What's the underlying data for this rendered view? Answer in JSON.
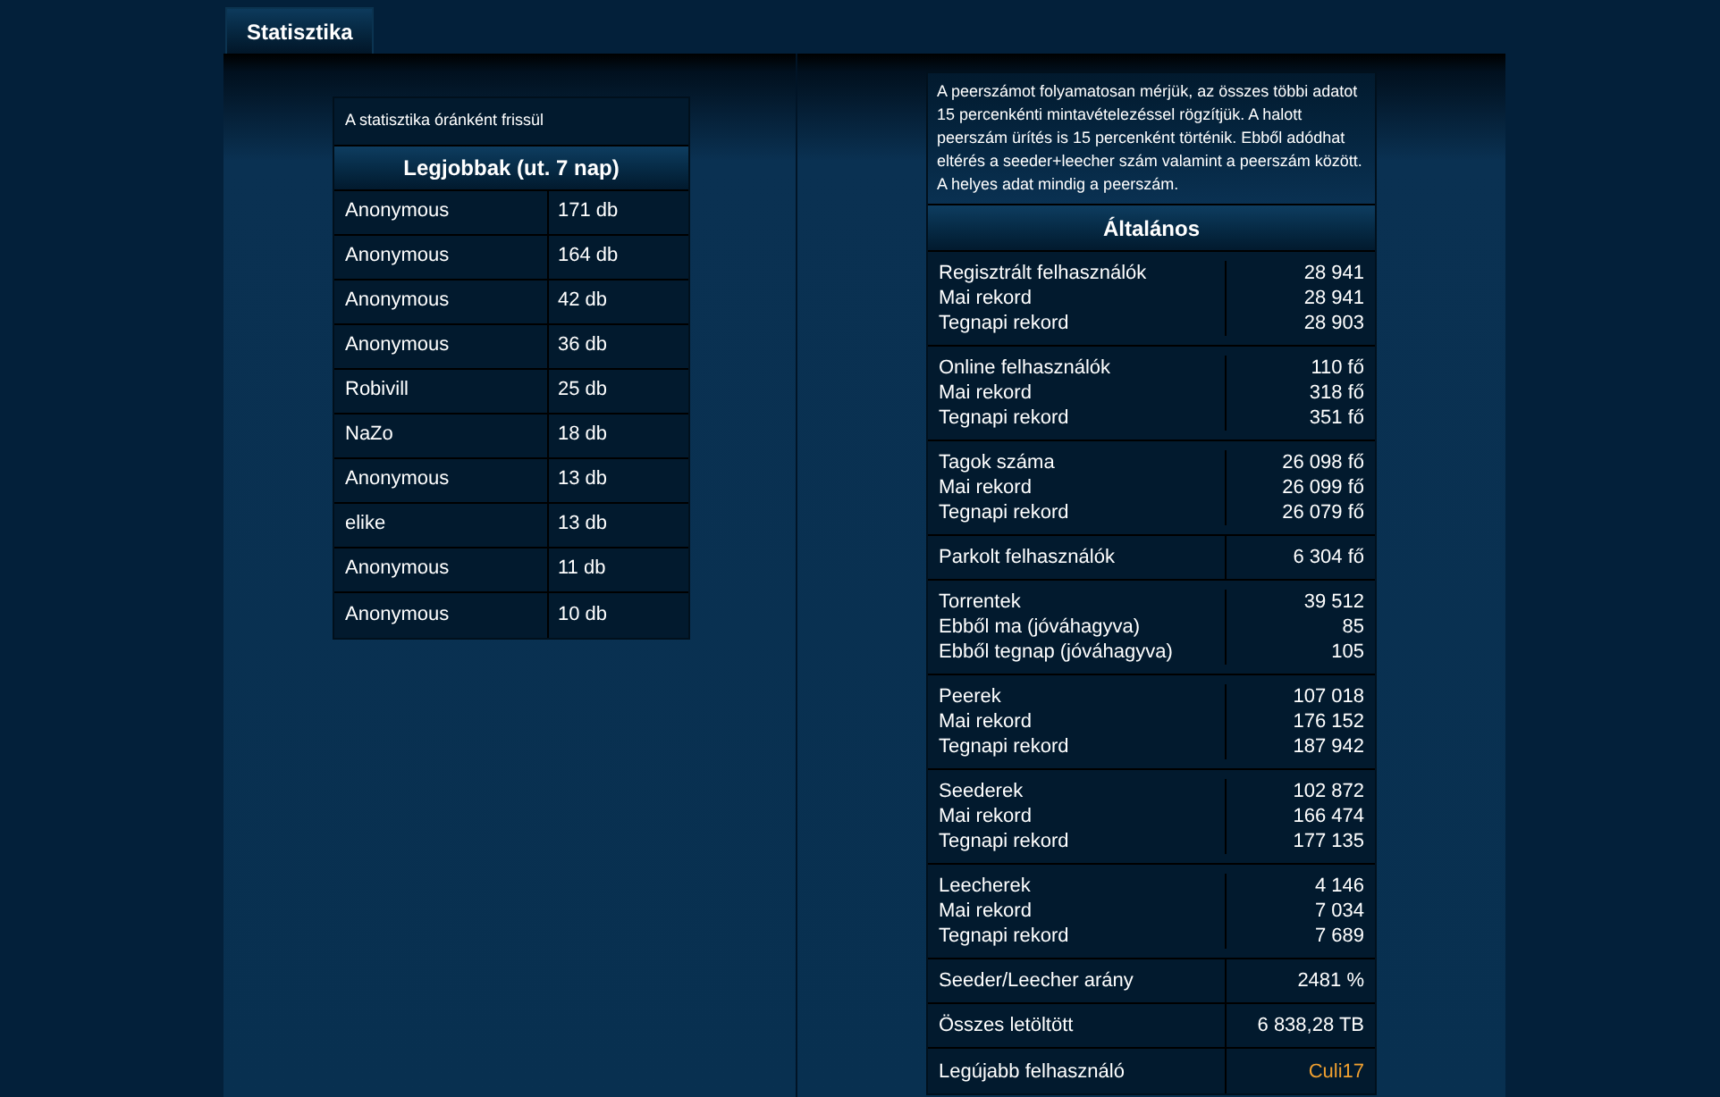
{
  "tabs": [
    {
      "label": "Statisztika",
      "selected": true
    }
  ],
  "top_users": {
    "note": "A statisztika óránként frissül",
    "title": "Legjobbak (ut. 7 nap)",
    "rows": [
      {
        "name": "Anonymous",
        "count": "171 db"
      },
      {
        "name": "Anonymous",
        "count": "164 db"
      },
      {
        "name": "Anonymous",
        "count": "42 db"
      },
      {
        "name": "Anonymous",
        "count": "36 db"
      },
      {
        "name": "Robivill",
        "count": "25 db"
      },
      {
        "name": "NaZo",
        "count": "18 db"
      },
      {
        "name": "Anonymous",
        "count": "13 db"
      },
      {
        "name": "elike",
        "count": "13 db"
      },
      {
        "name": "Anonymous",
        "count": "11 db"
      },
      {
        "name": "Anonymous",
        "count": "10 db"
      }
    ]
  },
  "general": {
    "note": "A peerszámot folyamatosan mérjük, az összes többi adatot 15 percenkénti mintavételezéssel rögzítjük. A halott peerszám ürítés is 15 percenként történik. Ebből adódhat eltérés a seeder+leecher szám valamint a peerszám között. A helyes adat mindig a peerszám.",
    "title": "Általános",
    "groups": [
      {
        "kind": "plain",
        "lines": [
          {
            "label": "Regisztrált felhasználók",
            "value": "28 941"
          },
          {
            "label": "Mai rekord",
            "value": "28 941"
          },
          {
            "label": "Tegnapi rekord",
            "value": "28 903"
          }
        ]
      },
      {
        "kind": "plain",
        "lines": [
          {
            "label": "Online felhasználók",
            "value": "110 fő"
          },
          {
            "label": "Mai rekord",
            "value": "318 fő"
          },
          {
            "label": "Tegnapi rekord",
            "value": "351 fő"
          }
        ]
      },
      {
        "kind": "plain",
        "lines": [
          {
            "label": "Tagok száma",
            "value": "26 098 fő"
          },
          {
            "label": "Mai rekord",
            "value": "26 099 fő"
          },
          {
            "label": "Tegnapi rekord",
            "value": "26 079 fő"
          }
        ]
      },
      {
        "kind": "plain",
        "lines": [
          {
            "label": "Parkolt felhasználók",
            "value": "6 304 fő"
          }
        ]
      },
      {
        "kind": "plain",
        "lines": [
          {
            "label": "Torrentek",
            "value": "39 512"
          },
          {
            "label": "Ebből ma (jóváhagyva)",
            "value": "85"
          },
          {
            "label": "Ebből tegnap (jóváhagyva)",
            "value": "105"
          }
        ]
      },
      {
        "kind": "plain",
        "lines": [
          {
            "label": "Peerek",
            "value": "107 018"
          },
          {
            "label": "Mai rekord",
            "value": "176 152"
          },
          {
            "label": "Tegnapi rekord",
            "value": "187 942"
          }
        ]
      },
      {
        "kind": "plain",
        "lines": [
          {
            "label": "Seederek",
            "value": "102 872"
          },
          {
            "label": "Mai rekord",
            "value": "166 474"
          },
          {
            "label": "Tegnapi rekord",
            "value": "177 135"
          }
        ]
      },
      {
        "kind": "plain",
        "lines": [
          {
            "label": "Leecherek",
            "value": "4 146"
          },
          {
            "label": "Mai rekord",
            "value": "7 034"
          },
          {
            "label": "Tegnapi rekord",
            "value": "7 689"
          }
        ]
      },
      {
        "kind": "plain",
        "lines": [
          {
            "label": "Seeder/Leecher arány",
            "value": "2481 %"
          }
        ]
      },
      {
        "kind": "plain",
        "lines": [
          {
            "label": "Összes letöltött",
            "value": "6 838,28 TB"
          }
        ]
      },
      {
        "kind": "link",
        "lines": [
          {
            "label": "Legújabb felhasználó",
            "value": "Culi17"
          }
        ]
      }
    ]
  }
}
